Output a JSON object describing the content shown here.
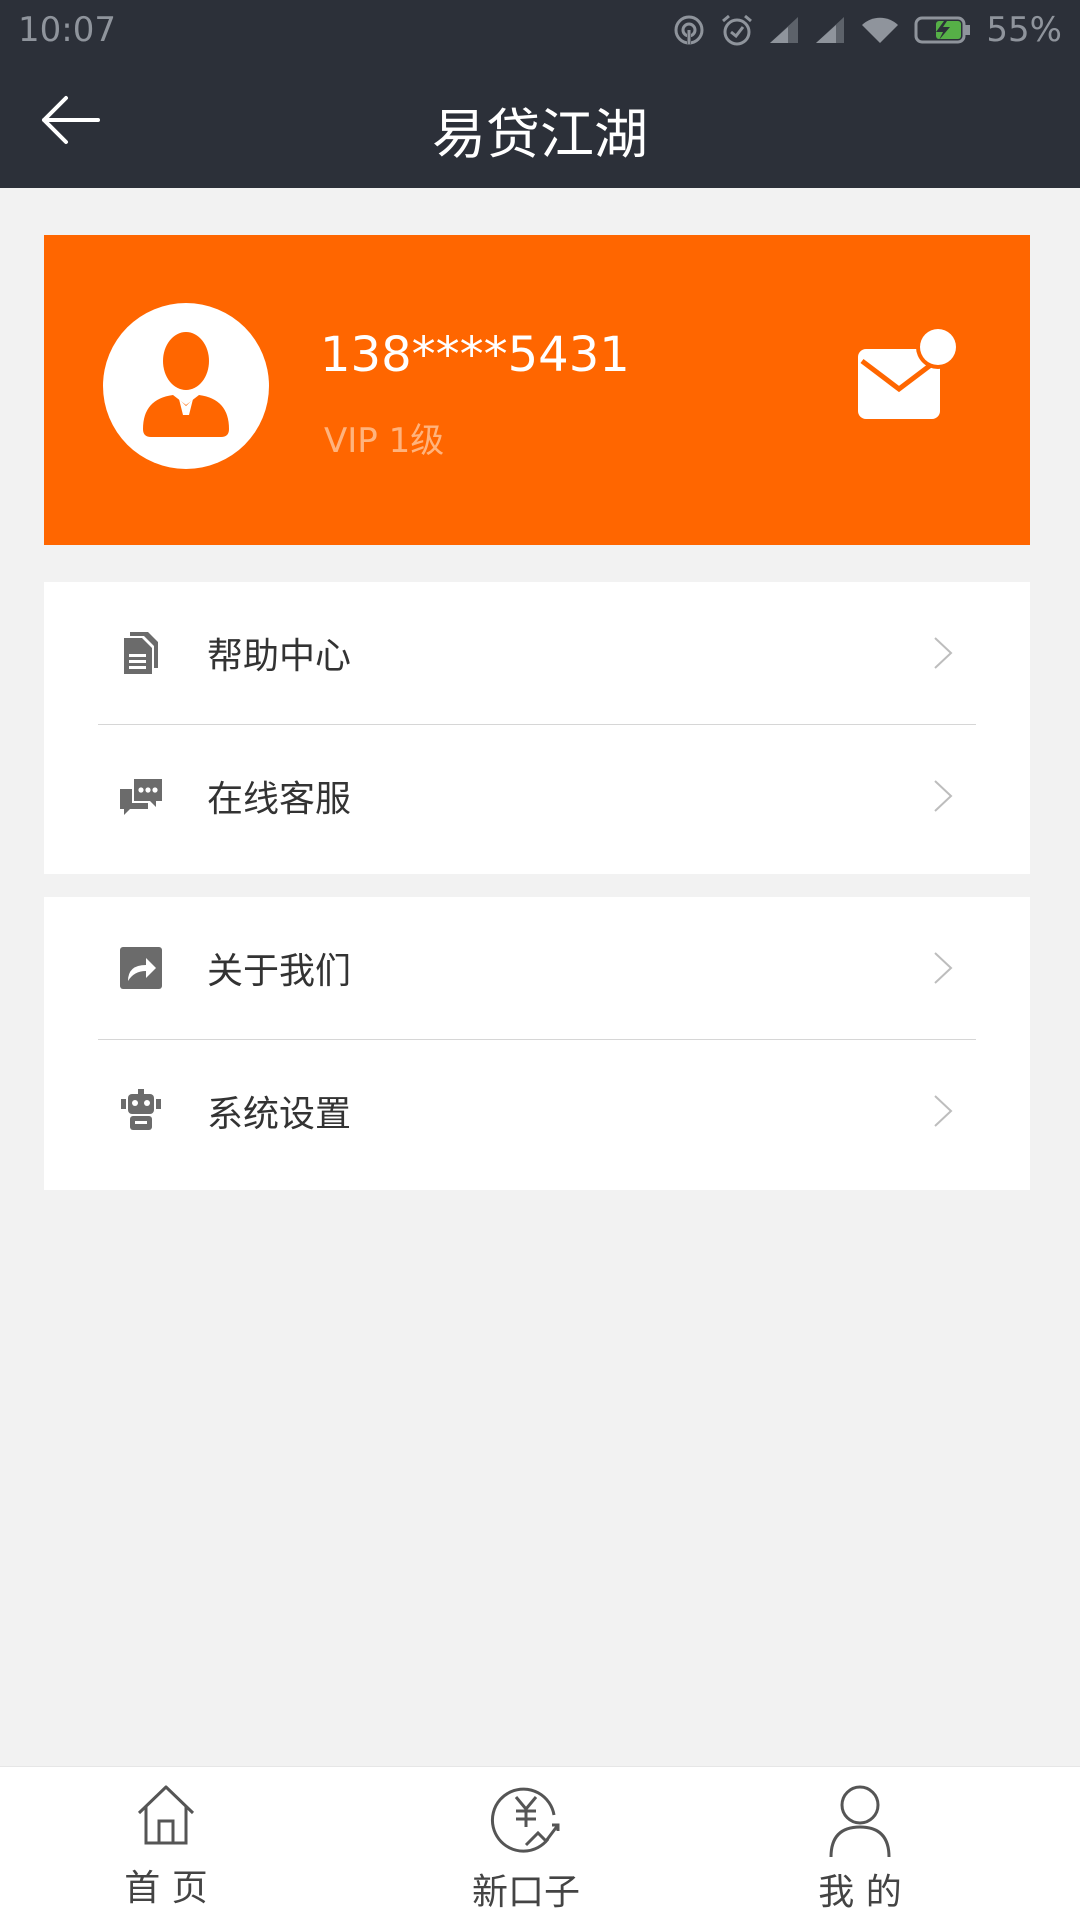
{
  "status_bar": {
    "time": "10:07",
    "battery": "55%"
  },
  "header": {
    "title": "易贷江湖"
  },
  "profile": {
    "phone": "138****5431",
    "vip_level": "VIP 1级"
  },
  "menu": {
    "group1": [
      {
        "label": "帮助中心",
        "icon": "document-icon"
      },
      {
        "label": "在线客服",
        "icon": "chat-icon"
      }
    ],
    "group2": [
      {
        "label": "关于我们",
        "icon": "share-icon"
      },
      {
        "label": "系统设置",
        "icon": "robot-icon"
      }
    ]
  },
  "bottom_nav": [
    {
      "label": "首 页",
      "icon": "home-icon"
    },
    {
      "label": "新口子",
      "icon": "yuan-icon"
    },
    {
      "label": "我 的",
      "icon": "user-icon"
    }
  ],
  "colors": {
    "header_bg": "#2c3039",
    "accent": "#ff6600",
    "page_bg": "#f2f2f2"
  }
}
